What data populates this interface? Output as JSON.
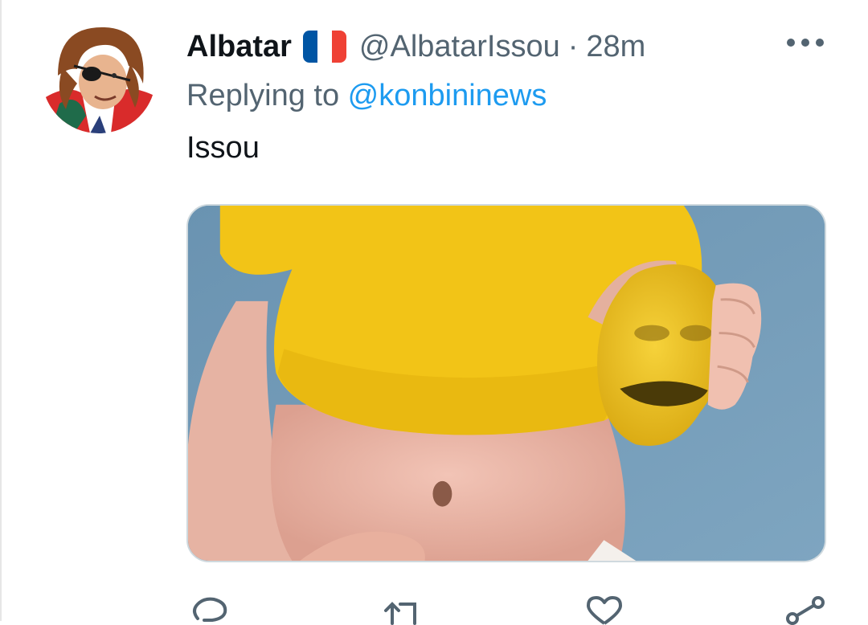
{
  "tweet": {
    "display_name": "Albatar",
    "handle": "@AlbatarIssou",
    "separator": "·",
    "time": "28m",
    "reply_prefix": "Replying to ",
    "reply_mention": "@konbininews",
    "text": "Issou"
  },
  "flag_colors": [
    "#0055a4",
    "#ffffff",
    "#ef4135"
  ],
  "icons": {
    "more": "more-horizontal-icon",
    "reply": "reply-icon",
    "retweet": "retweet-icon",
    "like": "like-icon",
    "share": "share-icon"
  },
  "colors": {
    "text": "#0f1419",
    "secondary": "#536471",
    "link": "#1d9bf0",
    "border": "#cfd9de"
  }
}
